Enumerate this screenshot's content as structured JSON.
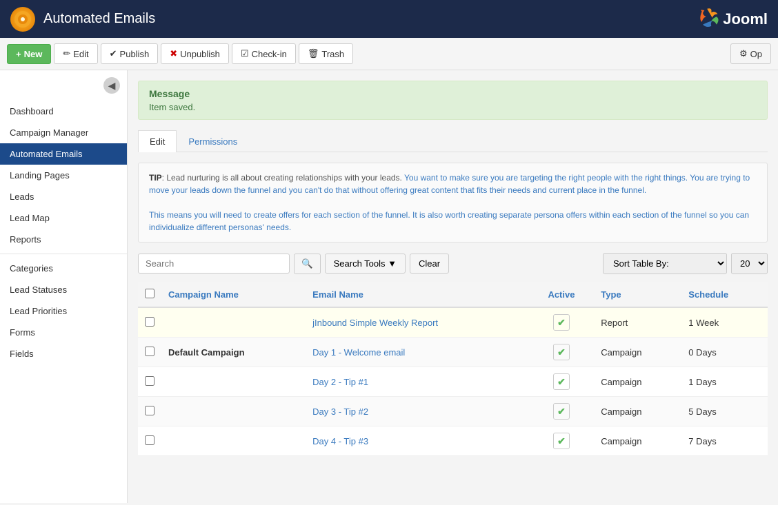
{
  "header": {
    "logo_symbol": "☀",
    "title": "Automated Emails",
    "joomla_label": "Jooml"
  },
  "toolbar": {
    "new_label": "New",
    "edit_label": "Edit",
    "publish_label": "Publish",
    "unpublish_label": "Unpublish",
    "checkin_label": "Check-in",
    "trash_label": "Trash",
    "options_label": "Op"
  },
  "sidebar": {
    "toggle_icon": "◀",
    "items": [
      {
        "id": "dashboard",
        "label": "Dashboard",
        "active": false
      },
      {
        "id": "campaign-manager",
        "label": "Campaign Manager",
        "active": false
      },
      {
        "id": "automated-emails",
        "label": "Automated Emails",
        "active": true
      },
      {
        "id": "landing-pages",
        "label": "Landing Pages",
        "active": false
      },
      {
        "id": "leads",
        "label": "Leads",
        "active": false
      },
      {
        "id": "lead-map",
        "label": "Lead Map",
        "active": false
      },
      {
        "id": "reports",
        "label": "Reports",
        "active": false
      }
    ],
    "secondary_items": [
      {
        "id": "categories",
        "label": "Categories",
        "active": false
      },
      {
        "id": "lead-statuses",
        "label": "Lead Statuses",
        "active": false
      },
      {
        "id": "lead-priorities",
        "label": "Lead Priorities",
        "active": false
      },
      {
        "id": "forms",
        "label": "Forms",
        "active": false
      },
      {
        "id": "fields",
        "label": "Fields",
        "active": false
      }
    ]
  },
  "message": {
    "title": "Message",
    "body": "Item saved."
  },
  "tabs": [
    {
      "id": "edit",
      "label": "Edit",
      "active": true
    },
    {
      "id": "permissions",
      "label": "Permissions",
      "active": false
    }
  ],
  "tip": {
    "label": "TIP",
    "text1": ": Lead nurturing is all about creating relationships with your leads. You want to make sure you are targeting the right people with the right things. You are trying to move your leads down the funnel and you can't do that without offering great content that fits their needs and current place in the funnel.",
    "text2": "This means you will need to create offers for each section of the funnel. It is also worth creating separate persona offers within each section of the funnel so you can individualize different personas' needs."
  },
  "search": {
    "placeholder": "Search",
    "search_tools_label": "Search Tools",
    "clear_label": "Clear",
    "sort_label": "Sort Table By:",
    "sort_placeholder": "Sort Table By:",
    "page_size": "20"
  },
  "table": {
    "headers": {
      "campaign_name": "Campaign Name",
      "email_name": "Email Name",
      "active": "Active",
      "type": "Type",
      "schedule": "Schedule"
    },
    "rows": [
      {
        "id": "row1",
        "campaign_name": "",
        "email_name": "jInbound Simple Weekly Report",
        "email_link": "#",
        "active": true,
        "type": "Report",
        "schedule": "1 Week",
        "highlight": true
      },
      {
        "id": "row2",
        "campaign_name": "Default Campaign",
        "email_name": "Day 1 - Welcome email",
        "email_link": "#",
        "active": true,
        "type": "Campaign",
        "schedule": "0 Days",
        "highlight": false
      },
      {
        "id": "row3",
        "campaign_name": "",
        "email_name": "Day 2 - Tip #1",
        "email_link": "#",
        "active": true,
        "type": "Campaign",
        "schedule": "1 Days",
        "highlight": false
      },
      {
        "id": "row4",
        "campaign_name": "",
        "email_name": "Day 3 - Tip #2",
        "email_link": "#",
        "active": true,
        "type": "Campaign",
        "schedule": "5 Days",
        "highlight": false
      },
      {
        "id": "row5",
        "campaign_name": "",
        "email_name": "Day 4 - Tip #3",
        "email_link": "#",
        "active": true,
        "type": "Campaign",
        "schedule": "7 Days",
        "highlight": false
      }
    ]
  }
}
